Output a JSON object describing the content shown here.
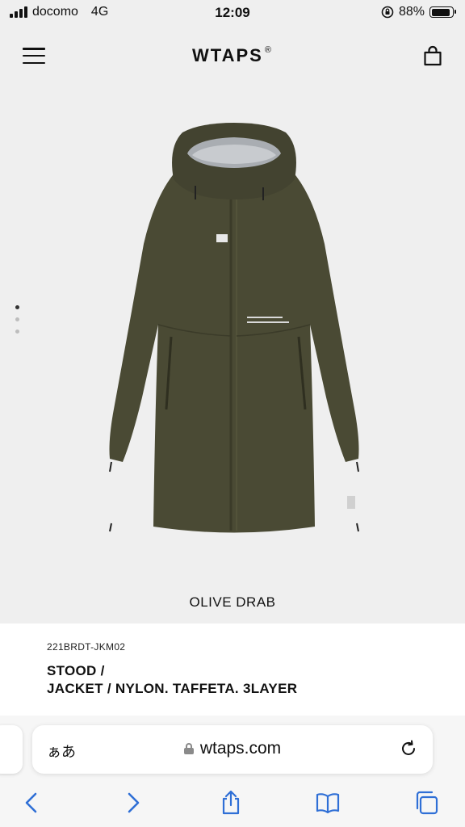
{
  "status_bar": {
    "carrier": "docomo",
    "network": "4G",
    "time": "12:09",
    "battery": "88%",
    "battery_level": 0.88
  },
  "header": {
    "logo": "WTAPS",
    "logo_mark": "®",
    "menu_icon": "hamburger-icon",
    "cart_icon": "bag-icon"
  },
  "gallery": {
    "image_count": 3,
    "active_index": 0,
    "color_name": "OLIVE DRAB",
    "product_color": "#4a4a34"
  },
  "product": {
    "sku": "221BRDT-JKM02",
    "title_line1": "STOOD /",
    "title_line2": "JACKET / NYLON. TAFFETA. 3LAYER"
  },
  "browser": {
    "text_size_button": "ぁあ",
    "url": "wtaps.com",
    "icons": [
      "back-icon",
      "forward-icon",
      "share-icon",
      "bookmarks-icon",
      "tabs-icon"
    ],
    "accent_color": "#2f6fd6"
  }
}
